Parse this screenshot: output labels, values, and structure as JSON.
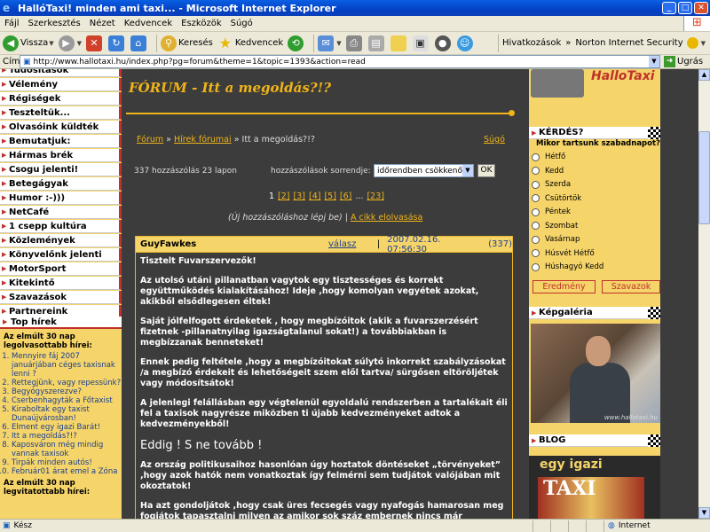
{
  "window": {
    "title": "HallóTaxi! minden ami taxi... - Microsoft Internet Explorer"
  },
  "menubar": [
    "Fájl",
    "Szerkesztés",
    "Nézet",
    "Kedvencek",
    "Eszközök",
    "Súgó"
  ],
  "toolbar": {
    "back": "Vissza",
    "search": "Keresés",
    "favorites": "Kedvencek",
    "links": "Hivatkozások",
    "norton": "Norton Internet Security"
  },
  "address": {
    "label": "Cím",
    "url": "http://www.hallotaxi.hu/index.php?pg=forum&theme=1&topic=1393&action=read",
    "go": "Ugrás"
  },
  "status": {
    "text": "Kész",
    "zone": "Internet"
  },
  "left_menu": [
    "Tudósítások",
    "Vélemény",
    "Régiségek",
    "Teszteltük...",
    "Olvasóink küldték",
    "Bemutatjuk:",
    "Hármas brék",
    "Csogu jelenti!",
    "Betegágyak",
    "Humor :-)))",
    "NetCafé",
    "1 csepp kultúra",
    "Közlemények",
    "Könyvelőnk jelenti",
    "MotorSport",
    "Kitekintő",
    "Szavazások",
    "Partnereink"
  ],
  "top_news": {
    "header": "Top hírek",
    "subtitle": "Az elmúlt 30 nap legolvasottabb hírei:",
    "items": [
      "Mennyire fáj 2007 januárjában céges taxisnak lenni ?",
      "Rettegjünk, vagy repessünk?",
      "Begyógyszerezve?",
      "Cserbenhagyták a Főtaxist",
      "Kiraboltak egy taxist Dunaújvárosban!",
      "Elment egy igazi Barát!",
      "Itt a megoldás?!?",
      "Kaposváron még mindig vannak taxisok",
      "Tirpák minden autós!",
      "Február01 árat emel a Zóna"
    ],
    "subtitle2": "Az elmúlt 30 nap legvitatottabb hírei:"
  },
  "forum": {
    "title": "FÓRUM - Itt a megoldás?!?",
    "crumb_forum": "Fórum",
    "crumb_sep1": "»",
    "crumb_news": "Hírek fórumai",
    "crumb_sep2": "»",
    "crumb_current": "Itt a megoldás?!?",
    "help": "Súgó",
    "count_text": "337 hozzászólás 23 lapon",
    "sort_label": "hozzászólások sorrendje:",
    "sort_value": "időrendben csökkenő",
    "ok": "OK",
    "pages": [
      "1",
      "[2]",
      "[3]",
      "[4]",
      "[5]",
      "[6]",
      "...",
      "[23]"
    ],
    "new_post_hint": "(Új hozzászóláshoz lépj be)",
    "new_post_sep": "|",
    "read_article": "A cikk elolvasása"
  },
  "post": {
    "author": "GuyFawkes",
    "reply": "válasz",
    "separator": "|",
    "date": "2007.02.16. 07:56:30",
    "number": "(337)",
    "paragraphs": [
      "Tisztelt Fuvarszervezők!",
      "Az utolsó utáni pillanatban vagytok egy tisztességes és korrekt együttműködés kialakításához! Ideje ,hogy komolyan vegyétek azokat, akikből elsődlegesen éltek!",
      "Saját jólfelfogott érdeketek , hogy megbízóitok (akik a fuvarszerzésért fizetnek -pillanatnyilag igazságtalanul sokat!) a továbbiakban is megbízzanak benneteket!",
      "Ennek pedig feltétele ,hogy a megbízóitokat súlytó inkorrekt szabályzásokat /a megbízó érdekeit és lehetőségeit szem elől tartva/ sürgősen eltöröljétek vagy módosítsátok!",
      "A jelenlegi felállásban egy végtelenül egyoldalú rendszerben a tartalékait éli fel a taxisok nagyrésze miközben ti újabb kedvezményeket adtok a kedvezményekből!",
      "Eddig ! S ne tovább !",
      "Az ország politikusaihoz hasonlóan úgy hoztatok döntéseket „törvényeket” ,hogy azok hatók nem vonatkoztak így felmérni sem tudjátok valójában mit okoztatok!",
      "Ha azt gondoljátok ,hogy csak üres fecsegés vagy nyafogás hamarosan meg fogjátok tapasztalni milyen az amikor sok száz embernek nincs már vesztenivalója!"
    ]
  },
  "right": {
    "top_image_text": "HalloTaxi",
    "poll_header": "KÉRDÉS?",
    "poll_question": "Mikor tartsunk szabadnapot?",
    "poll_options": [
      "Hétfő",
      "Kedd",
      "Szerda",
      "Csütörtök",
      "Péntek",
      "Szombat",
      "Vasárnap",
      "Húsvét Hétfő",
      "Húshagyó Kedd"
    ],
    "results_btn": "Eredmény",
    "vote_btn": "Szavazok",
    "gallery_header": "Képgaléria",
    "gallery_watermark": "www.hallotaxi.hu",
    "blog_header": "BLOG",
    "blog_image_text": "egy igazi",
    "blog_image_sign": "TAXI"
  }
}
